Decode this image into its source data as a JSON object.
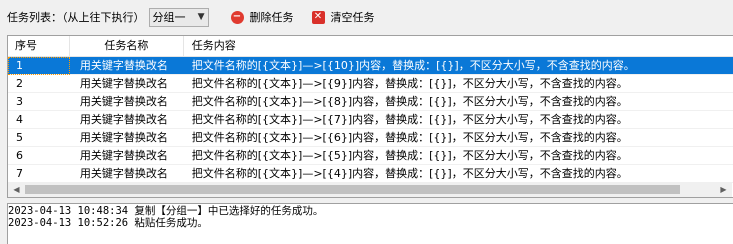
{
  "toolbar": {
    "task_list_label": "任务列表：（从上往下执行）",
    "group_selected": "分组一",
    "delete_label": "删除任务",
    "clear_label": "清空任务"
  },
  "table": {
    "columns": [
      "序号",
      "任务名称",
      "任务内容"
    ],
    "rows": [
      {
        "index": "1",
        "name": "用关键字替换改名",
        "content": "把文件名称的[{文本}]—>[{10}]内容，替换成：[{}]，不区分大小写，不含查找的内容。",
        "selected": true
      },
      {
        "index": "2",
        "name": "用关键字替换改名",
        "content": "把文件名称的[{文本}]—>[{9}]内容，替换成：[{}]，不区分大小写，不含查找的内容。",
        "selected": false
      },
      {
        "index": "3",
        "name": "用关键字替换改名",
        "content": "把文件名称的[{文本}]—>[{8}]内容，替换成：[{}]，不区分大小写，不含查找的内容。",
        "selected": false
      },
      {
        "index": "4",
        "name": "用关键字替换改名",
        "content": "把文件名称的[{文本}]—>[{7}]内容，替换成：[{}]，不区分大小写，不含查找的内容。",
        "selected": false
      },
      {
        "index": "5",
        "name": "用关键字替换改名",
        "content": "把文件名称的[{文本}]—>[{6}]内容，替换成：[{}]，不区分大小写，不含查找的内容。",
        "selected": false
      },
      {
        "index": "6",
        "name": "用关键字替换改名",
        "content": "把文件名称的[{文本}]—>[{5}]内容，替换成：[{}]，不区分大小写，不含查找的内容。",
        "selected": false
      },
      {
        "index": "7",
        "name": "用关键字替换改名",
        "content": "把文件名称的[{文本}]—>[{4}]内容，替换成：[{}]，不区分大小写，不含查找的内容。",
        "selected": false
      }
    ]
  },
  "log": {
    "lines": [
      "2023-04-13 10:48:34 复制【分组一】中已选择好的任务成功。",
      "2023-04-13 10:52:26 粘贴任务成功。"
    ]
  },
  "colors": {
    "selection": "#0a78d7",
    "delete_icon": "#e03a2f",
    "clear_icon": "#d9302a"
  },
  "icons": {
    "delete": "minus-circle-icon",
    "clear": "x-square-icon",
    "combo": "chevron-down-icon"
  }
}
